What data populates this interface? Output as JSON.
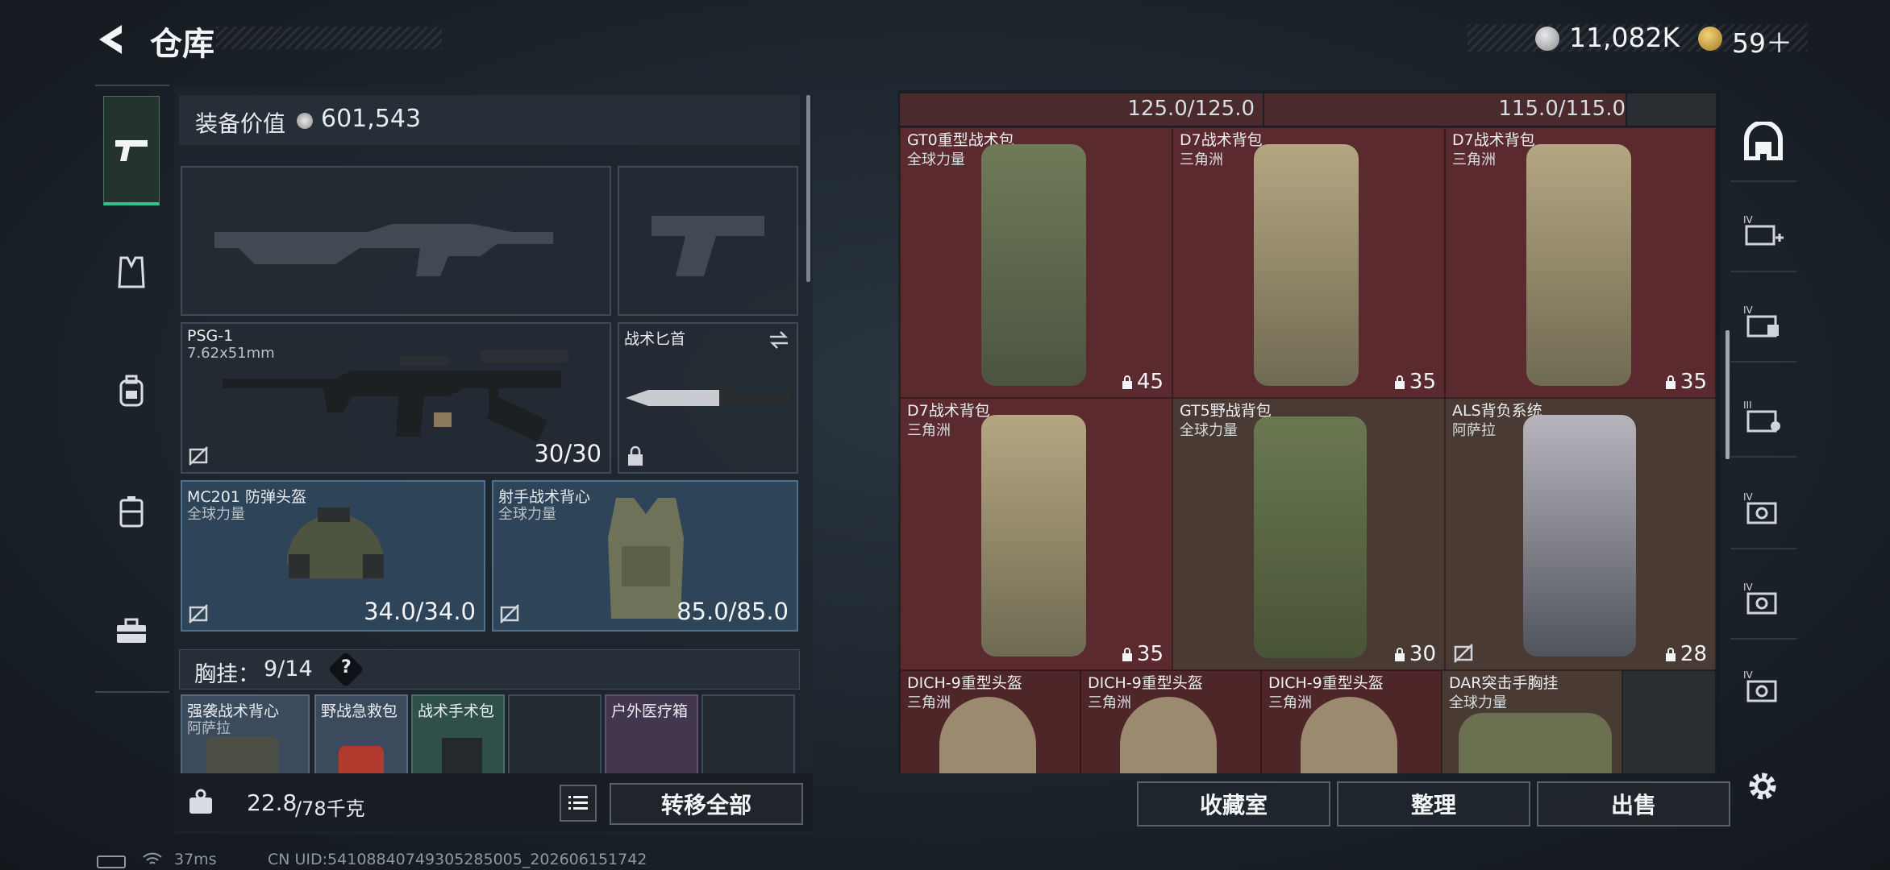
{
  "header": {
    "title": "仓库",
    "currency_primary": "11,082K",
    "currency_secondary": "59＋"
  },
  "nav": {
    "items": [
      {
        "name": "weapons",
        "icon": "pistol-icon"
      },
      {
        "name": "vest",
        "icon": "vest-icon"
      },
      {
        "name": "backpack",
        "icon": "backpack-icon"
      },
      {
        "name": "container",
        "icon": "case-icon"
      },
      {
        "name": "toolbox",
        "icon": "toolbox-icon"
      }
    ]
  },
  "equipment": {
    "value_label": "装备价值",
    "value": "601,543",
    "primary_weapon": {
      "name": "PSG-1",
      "caliber": "7.62x51mm",
      "ammo": "30/30"
    },
    "melee": {
      "name": "战术匕首"
    },
    "helmet": {
      "name": "MC201 防弹头盔",
      "source": "全球力量",
      "durability": "34.0/34.0"
    },
    "armor": {
      "name": "射手战术背心",
      "source": "全球力量",
      "durability": "85.0/85.0"
    },
    "chest_label": "胸挂：",
    "chest_count": "9/14",
    "chest_help": "?",
    "chest_items": [
      {
        "name": "强袭战术背心",
        "source": "阿萨拉"
      },
      {
        "name": "野战急救包",
        "source": ""
      },
      {
        "name": "战术手术包",
        "source": ""
      },
      {
        "name": "",
        "source": ""
      },
      {
        "name": "户外医疗箱",
        "source": ""
      },
      {
        "name": "",
        "source": ""
      }
    ]
  },
  "bottom": {
    "weight_current": "22.8",
    "weight_max": "/78千克",
    "transfer_all": "转移全部"
  },
  "storage": {
    "capacities": [
      "125.0/125.0",
      "115.0/115.0"
    ],
    "items": [
      {
        "name": "GT0重型战术包",
        "source": "全球力量",
        "count": "45",
        "color": "#6f7a58"
      },
      {
        "name": "D7战术背包",
        "source": "三角洲",
        "count": "35",
        "color": "#a89a78"
      },
      {
        "name": "D7战术背包",
        "source": "三角洲",
        "count": "35",
        "color": "#a89a78"
      },
      {
        "name": "D7战术背包",
        "source": "三角洲",
        "count": "35",
        "color": "#a89a78"
      },
      {
        "name": "GT5野战背包",
        "source": "全球力量",
        "count": "30",
        "color": "#5c6a48"
      },
      {
        "name": "ALS背负系统",
        "source": "阿萨拉",
        "count": "28",
        "color": "#8a8c94"
      },
      {
        "name": "DICH-9重型头盔",
        "source": "三角洲",
        "count": "",
        "color": "#9c8a70"
      },
      {
        "name": "DICH-9重型头盔",
        "source": "三角洲",
        "count": "",
        "color": "#9c8a70"
      },
      {
        "name": "DICH-9重型头盔",
        "source": "三角洲",
        "count": "",
        "color": "#9c8a70"
      },
      {
        "name": "DAR突击手胸挂",
        "source": "全球力量",
        "count": "",
        "color": "#6a7050"
      }
    ],
    "buttons": {
      "collection": "收藏室",
      "organize": "整理",
      "sell": "出售"
    }
  },
  "right_sidebar": {
    "items": [
      "home-icon",
      "add-container-icon",
      "container-ii-icon",
      "container-iii-icon",
      "container-iv-icon",
      "container-iv-icon",
      "container-iv-icon"
    ]
  },
  "status": {
    "ping": "37ms",
    "uid": "CN UID:5410884074930528500​5_202606151742"
  }
}
